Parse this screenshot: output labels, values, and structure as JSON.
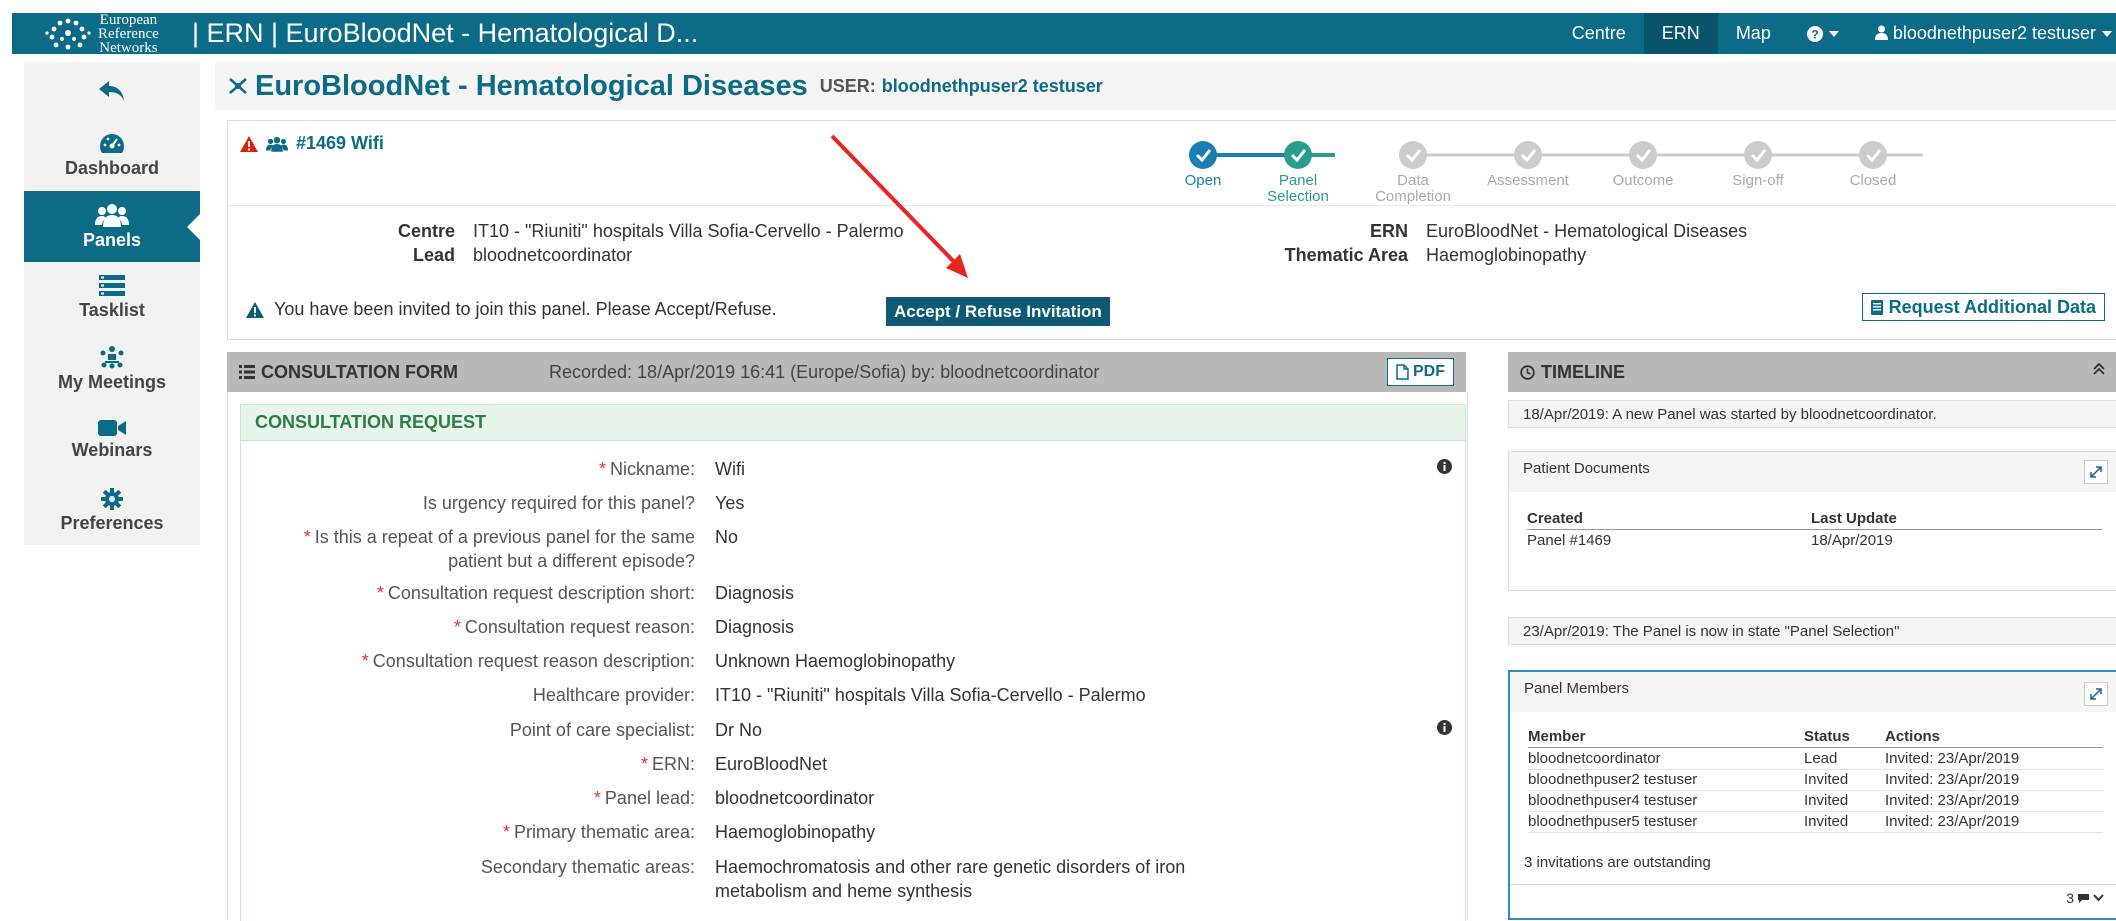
{
  "topbar": {
    "logo_lines": [
      "European",
      "Reference",
      "Networks"
    ],
    "app_title": "| ERN | EuroBloodNet - Hematological D...",
    "nav": [
      "Centre",
      "ERN",
      "Map"
    ],
    "user": "bloodnethpuser2 testuser"
  },
  "sidebar": {
    "items": [
      {
        "label": "Dashboard",
        "icon": "dashboard-icon"
      },
      {
        "label": "Panels",
        "icon": "users-icon"
      },
      {
        "label": "Tasklist",
        "icon": "tasklist-icon"
      },
      {
        "label": "My Meetings",
        "icon": "meetings-icon"
      },
      {
        "label": "Webinars",
        "icon": "video-camera-icon"
      },
      {
        "label": "Preferences",
        "icon": "gear-icon"
      }
    ]
  },
  "header": {
    "title": "EuroBloodNet - Hematological Diseases",
    "user_label": "USER:",
    "user_name": "bloodnethpuser2 testuser"
  },
  "panel": {
    "id_label": "#1469 Wifi",
    "steps": [
      {
        "label": "Open",
        "state": "done"
      },
      {
        "label": "Panel Selection",
        "state": "current"
      },
      {
        "label": "Data Completion",
        "state": "pending"
      },
      {
        "label": "Assessment",
        "state": "pending"
      },
      {
        "label": "Outcome",
        "state": "pending"
      },
      {
        "label": "Sign-off",
        "state": "pending"
      },
      {
        "label": "Closed",
        "state": "pending"
      }
    ],
    "centre_label": "Centre",
    "centre_value": "IT10 - \"Riuniti\" hospitals Villa Sofia-Cervello - Palermo",
    "lead_label": "Lead",
    "lead_value": "bloodnetcoordinator",
    "ern_label": "ERN",
    "ern_value": "EuroBloodNet - Hematological Diseases",
    "thematic_label": "Thematic Area",
    "thematic_value": "Haemoglobinopathy",
    "invite_text": "You have been invited to join this panel. Please Accept/Refuse.",
    "accept_button": "Accept / Refuse Invitation",
    "request_button": "Request Additional Data"
  },
  "form": {
    "title": "CONSULTATION FORM",
    "recorded": "Recorded: 18/Apr/2019 16:41 (Europe/Sofia) by: bloodnetcoordinator",
    "pdf_label": "PDF",
    "section_title": "CONSULTATION REQUEST",
    "fields": [
      {
        "label": "Nickname:",
        "value": "Wifi",
        "required": true,
        "info": true
      },
      {
        "label": "Is urgency required for this panel?",
        "value": "Yes",
        "required": false
      },
      {
        "label": "Is this a repeat of a previous panel for the same patient but a different episode?",
        "value": "No",
        "required": true
      },
      {
        "label": "Consultation request description short:",
        "value": "Diagnosis",
        "required": true
      },
      {
        "label": "Consultation request reason:",
        "value": "Diagnosis",
        "required": true
      },
      {
        "label": "Consultation request reason description:",
        "value": "Unknown Haemoglobinopathy",
        "required": true
      },
      {
        "label": "Healthcare provider:",
        "value": "IT10 - \"Riuniti\" hospitals Villa Sofia-Cervello - Palermo",
        "required": false
      },
      {
        "label": "Point of care specialist:",
        "value": "Dr No",
        "required": false,
        "info": true
      },
      {
        "label": "ERN:",
        "value": "EuroBloodNet",
        "required": true
      },
      {
        "label": "Panel lead:",
        "value": "bloodnetcoordinator",
        "required": true
      },
      {
        "label": "Primary thematic area:",
        "value": "Haemoglobinopathy",
        "required": true
      },
      {
        "label": "Secondary thematic areas:",
        "value": "Haemochromatosis and other rare genetic disorders of iron metabolism and heme synthesis",
        "required": false
      }
    ]
  },
  "timeline": {
    "title": "TIMELINE",
    "entry1": "18/Apr/2019: A new Panel was started by bloodnetcoordinator.",
    "docs": {
      "title": "Patient Documents",
      "col_created": "Created",
      "col_update": "Last Update",
      "rows": [
        {
          "created": "Panel #1469",
          "update": "18/Apr/2019"
        }
      ]
    },
    "entry2": "23/Apr/2019: The Panel is now in state \"Panel Selection\"",
    "members": {
      "title": "Panel Members",
      "col_member": "Member",
      "col_status": "Status",
      "col_actions": "Actions",
      "rows": [
        {
          "member": "bloodnetcoordinator",
          "status": "Lead",
          "action": "Invited: 23/Apr/2019"
        },
        {
          "member": "bloodnethpuser2 testuser",
          "status": "Invited",
          "action": "Invited: 23/Apr/2019"
        },
        {
          "member": "bloodnethpuser4 testuser",
          "status": "Invited",
          "action": "Invited: 23/Apr/2019"
        },
        {
          "member": "bloodnethpuser5 testuser",
          "status": "Invited",
          "action": "Invited: 23/Apr/2019"
        }
      ],
      "outstanding": "3 invitations are outstanding",
      "comment_count": "3"
    }
  },
  "colors": {
    "brand": "#0c6b86",
    "done": "#2a9d8f",
    "open": "#1c7fb4",
    "alert": "#d9230f"
  }
}
